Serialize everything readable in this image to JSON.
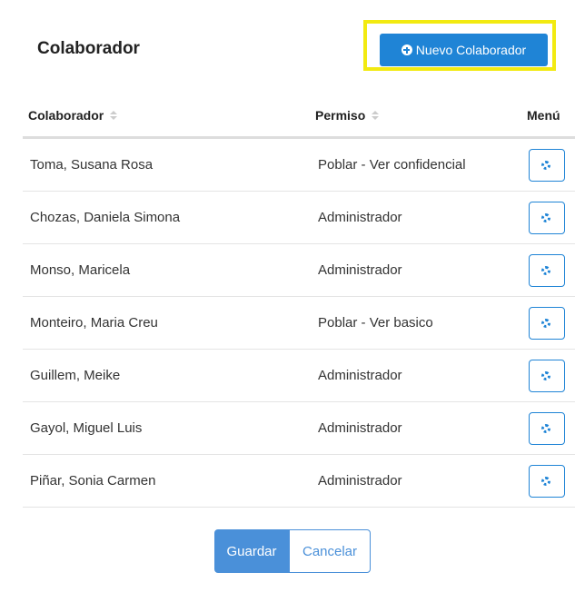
{
  "header": {
    "title": "Colaborador",
    "new_button_label": "Nuevo Colaborador",
    "highlight_color": "#f2ea11",
    "accent_color": "#1f84d6"
  },
  "table": {
    "columns": {
      "colaborador": "Colaborador",
      "permiso": "Permiso",
      "menu": "Menú"
    },
    "rows": [
      {
        "name": "Toma, Susana Rosa",
        "permission": "Poblar - Ver confidencial"
      },
      {
        "name": "Chozas, Daniela Simona",
        "permission": "Administrador"
      },
      {
        "name": "Monso, Maricela",
        "permission": "Administrador"
      },
      {
        "name": "Monteiro, Maria Creu",
        "permission": "Poblar - Ver basico"
      },
      {
        "name": "Guillem, Meike",
        "permission": "Administrador"
      },
      {
        "name": "Gayol, Miguel Luis",
        "permission": "Administrador"
      },
      {
        "name": "Piñar, Sonia Carmen",
        "permission": "Administrador"
      }
    ],
    "row_action_icon": "gear-icon"
  },
  "footer": {
    "save_label": "Guardar",
    "cancel_label": "Cancelar"
  }
}
